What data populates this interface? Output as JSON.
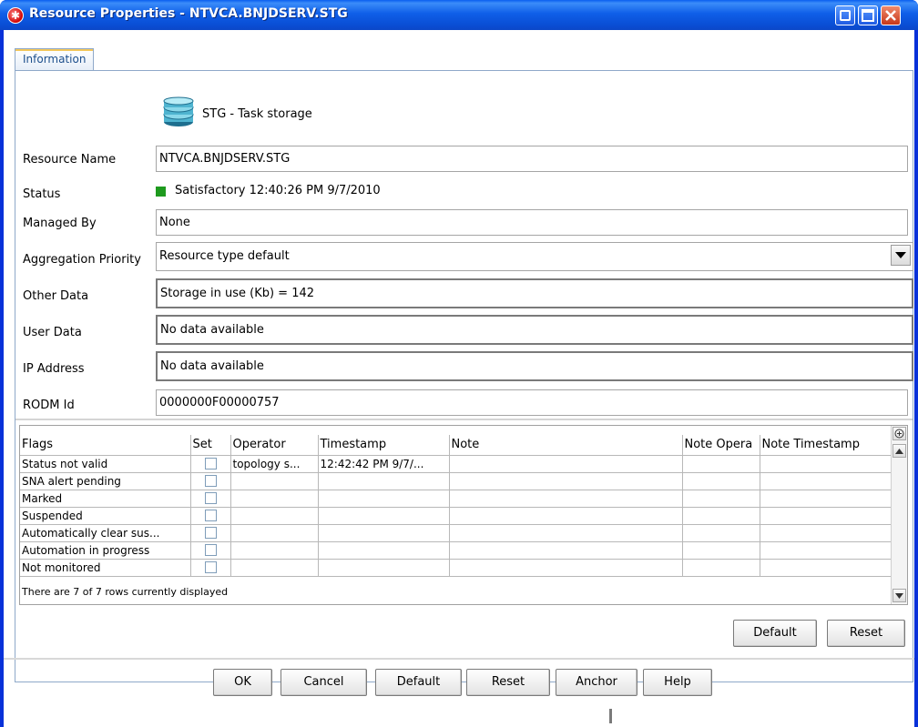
{
  "window": {
    "title": "Resource Properties - NTVCA.BNJDSERV.STG",
    "app_icon": "red-gear-icon",
    "controls": [
      "minimize-icon",
      "maximize-icon",
      "close-icon"
    ]
  },
  "tabs": [
    {
      "label": "Information",
      "selected": true
    }
  ],
  "header": {
    "icon": "database-stack-icon",
    "text": "STG - Task storage"
  },
  "fields": {
    "resource_name": {
      "label": "Resource Name",
      "value": "NTVCA.BNJDSERV.STG"
    },
    "status": {
      "label": "Status",
      "value": "Satisfactory  12:40:26 PM  9/7/2010",
      "color": "#1e9a1e"
    },
    "managed_by": {
      "label": "Managed By",
      "value": "None"
    },
    "aggregation_priority": {
      "label": "Aggregation Priority",
      "value": "Resource type default"
    },
    "other_data": {
      "label": "Other Data",
      "value": "Storage in use (Kb) =  142"
    },
    "user_data": {
      "label": "User Data",
      "value": "No data available"
    },
    "ip_address": {
      "label": "IP Address",
      "value": "No data available"
    },
    "rodm_id": {
      "label": "RODM Id",
      "value": "0000000F00000757"
    }
  },
  "flags_table": {
    "columns": [
      "Flags",
      "Set",
      "Operator",
      "Timestamp",
      "Note",
      "Note Opera",
      "Note Timestamp"
    ],
    "rows": [
      {
        "flag": "Status not valid",
        "set": false,
        "operator": "topology s...",
        "timestamp": "12:42:42 PM  9/7/...",
        "note": "",
        "note_operator": "",
        "note_timestamp": ""
      },
      {
        "flag": "SNA alert pending",
        "set": false,
        "operator": "",
        "timestamp": "",
        "note": "",
        "note_operator": "",
        "note_timestamp": ""
      },
      {
        "flag": "Marked",
        "set": false,
        "operator": "",
        "timestamp": "",
        "note": "",
        "note_operator": "",
        "note_timestamp": ""
      },
      {
        "flag": "Suspended",
        "set": false,
        "operator": "",
        "timestamp": "",
        "note": "",
        "note_operator": "",
        "note_timestamp": ""
      },
      {
        "flag": "Automatically clear sus...",
        "set": false,
        "operator": "",
        "timestamp": "",
        "note": "",
        "note_operator": "",
        "note_timestamp": ""
      },
      {
        "flag": "Automation in progress",
        "set": false,
        "operator": "",
        "timestamp": "",
        "note": "",
        "note_operator": "",
        "note_timestamp": ""
      },
      {
        "flag": "Not monitored",
        "set": false,
        "operator": "",
        "timestamp": "",
        "note": "",
        "note_operator": "",
        "note_timestamp": ""
      }
    ],
    "footer": "There are 7 of 7 rows currently displayed"
  },
  "table_buttons": {
    "default": "Default",
    "reset": "Reset"
  },
  "dialog_buttons": {
    "ok": "OK",
    "cancel": "Cancel",
    "default": "Default",
    "reset": "Reset",
    "anchor": "Anchor",
    "help": "Help"
  }
}
